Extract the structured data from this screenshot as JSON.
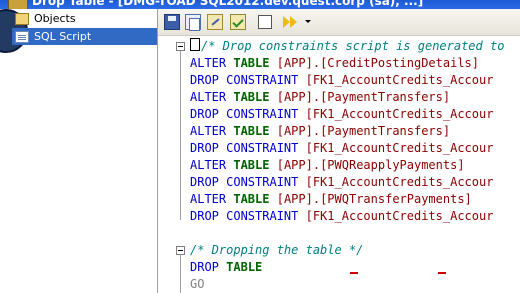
{
  "window": {
    "title": "Drop Table - [DMG-TOAD SQL2012.dev.quest.corp (sa), ...]"
  },
  "sidebar": {
    "items": [
      {
        "label": "Objects",
        "icon": "objects-icon",
        "selected": false
      },
      {
        "label": "SQL Script",
        "icon": "sql-script-icon",
        "selected": true
      }
    ]
  },
  "toolbar": {
    "buttons": [
      {
        "name": "save",
        "icon": "save-icon"
      },
      {
        "name": "copy",
        "icon": "copy-icon"
      },
      {
        "name": "edit",
        "icon": "edit-script-icon"
      },
      {
        "name": "check",
        "icon": "check-syntax-icon"
      },
      {
        "name": "toggle",
        "icon": "checkbox-icon"
      },
      {
        "name": "run",
        "icon": "execute-icon"
      },
      {
        "name": "dropdown",
        "icon": "chevron-down-icon"
      }
    ]
  },
  "editor": {
    "lines": [
      {
        "comment": "/* Drop constraints script is generated to"
      },
      {
        "kw1": "ALTER",
        "kw2": "TABLE",
        "obj": "[APP].[CreditPostingDetails]"
      },
      {
        "kw1": "DROP CONSTRAINT",
        "obj": "[FK1_AccountCredits_Accour"
      },
      {
        "kw1": "ALTER",
        "kw2": "TABLE",
        "obj": "[APP].[PaymentTransfers]"
      },
      {
        "kw1": "DROP CONSTRAINT",
        "obj": "[FK1_AccountCredits_Accour"
      },
      {
        "kw1": "ALTER",
        "kw2": "TABLE",
        "obj": "[APP].[PaymentTransfers]"
      },
      {
        "kw1": "DROP CONSTRAINT",
        "obj": "[FK1_AccountCredits_Accour"
      },
      {
        "kw1": "ALTER",
        "kw2": "TABLE",
        "obj": "[APP].[PWQReapplyPayments]"
      },
      {
        "kw1": "DROP CONSTRAINT",
        "obj": "[FK1_AccountCredits_Accour"
      },
      {
        "kw1": "ALTER",
        "kw2": "TABLE",
        "obj": "[APP].[PWQTransferPayments]"
      },
      {
        "kw1": "DROP CONSTRAINT",
        "obj": "[FK1_AccountCredits_Accour"
      },
      {
        "comment": "/* Dropping the table */"
      },
      {
        "kw1": "DROP",
        "kw2": "TABLE"
      },
      {
        "go": "GO"
      }
    ],
    "colors": {
      "keyword": "#0000cc",
      "table_keyword": "#006400",
      "object": "#8b0000",
      "comment": "#008080",
      "go": "#808080"
    }
  }
}
